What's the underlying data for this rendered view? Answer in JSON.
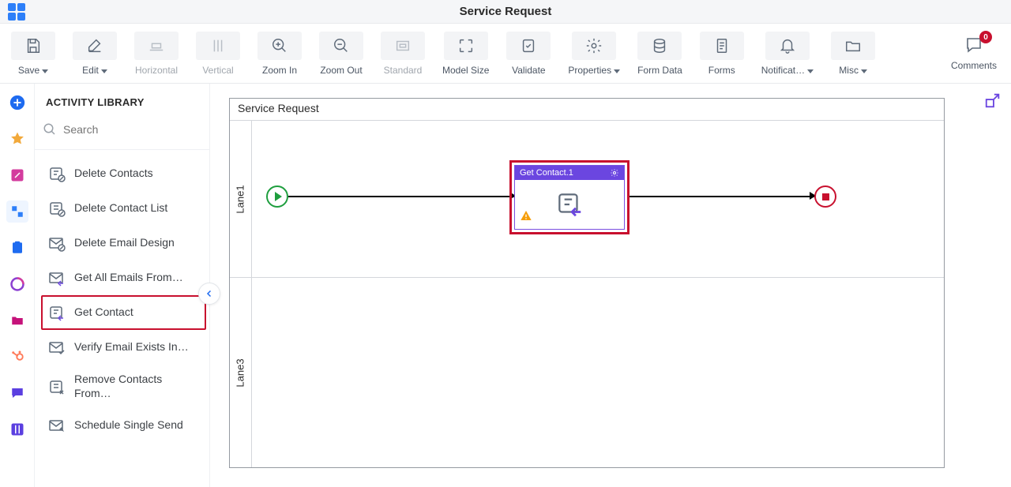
{
  "header": {
    "title": "Service Request"
  },
  "toolbar": {
    "save": "Save",
    "edit": "Edit",
    "horizontal": "Horizontal",
    "vertical": "Vertical",
    "zoom_in": "Zoom In",
    "zoom_out": "Zoom Out",
    "standard": "Standard",
    "model_size": "Model Size",
    "validate": "Validate",
    "properties": "Properties",
    "form_data": "Form Data",
    "forms": "Forms",
    "notifications": "Notificat…",
    "misc": "Misc",
    "comments": "Comments",
    "comments_badge": "0"
  },
  "sidebar": {
    "heading": "ACTIVITY LIBRARY",
    "search_placeholder": "Search",
    "items": [
      {
        "label": "Delete Contacts"
      },
      {
        "label": "Delete Contact List"
      },
      {
        "label": "Delete Email Design"
      },
      {
        "label": "Get All Emails From…"
      },
      {
        "label": "Get Contact"
      },
      {
        "label": "Verify Email Exists In…"
      },
      {
        "label": "Remove Contacts From…"
      },
      {
        "label": "Schedule Single Send"
      }
    ]
  },
  "canvas": {
    "pool_title": "Service Request",
    "lane1": "Lane1",
    "lane3": "Lane3",
    "task_title": "Get Contact.1"
  }
}
